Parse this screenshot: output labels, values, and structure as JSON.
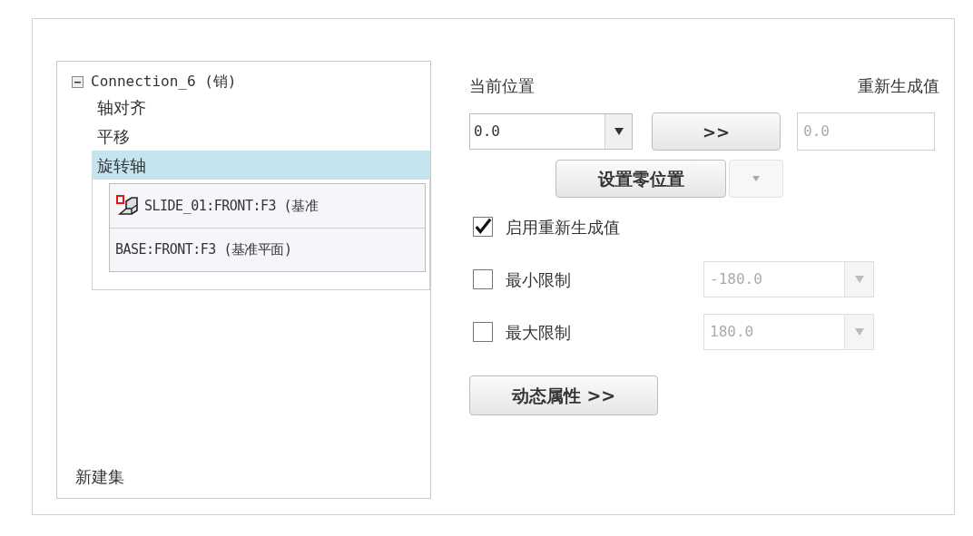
{
  "tree": {
    "label": "Connection_6 (销)",
    "expanded": true,
    "children": [
      {
        "label": "轴对齐",
        "selected": false
      },
      {
        "label": "平移",
        "selected": false
      },
      {
        "label": "旋转轴",
        "selected": true,
        "references": [
          {
            "kind": "part",
            "label": "SLIDE_01:FRONT:F3 (基准"
          },
          {
            "kind": "plain",
            "label": "BASE:FRONT:F3 (基准平面)"
          }
        ]
      }
    ]
  },
  "new_set": "新建集",
  "current_position": {
    "label": "当前位置",
    "value": "0.0"
  },
  "regen_header": "重新生成值",
  "copy_button": ">>",
  "regen_field": {
    "value": "0.0",
    "disabled": true
  },
  "set_zero_button": "设置零位置",
  "options": [
    {
      "kind": "check",
      "label": "启用重新生成值",
      "checked": true
    },
    {
      "kind": "limit",
      "label": "最小限制",
      "checked": false,
      "value": "-180.0"
    },
    {
      "kind": "limit",
      "label": "最大限制",
      "checked": false,
      "value": "180.0"
    }
  ],
  "dynamic_button": "动态属性 >>"
}
